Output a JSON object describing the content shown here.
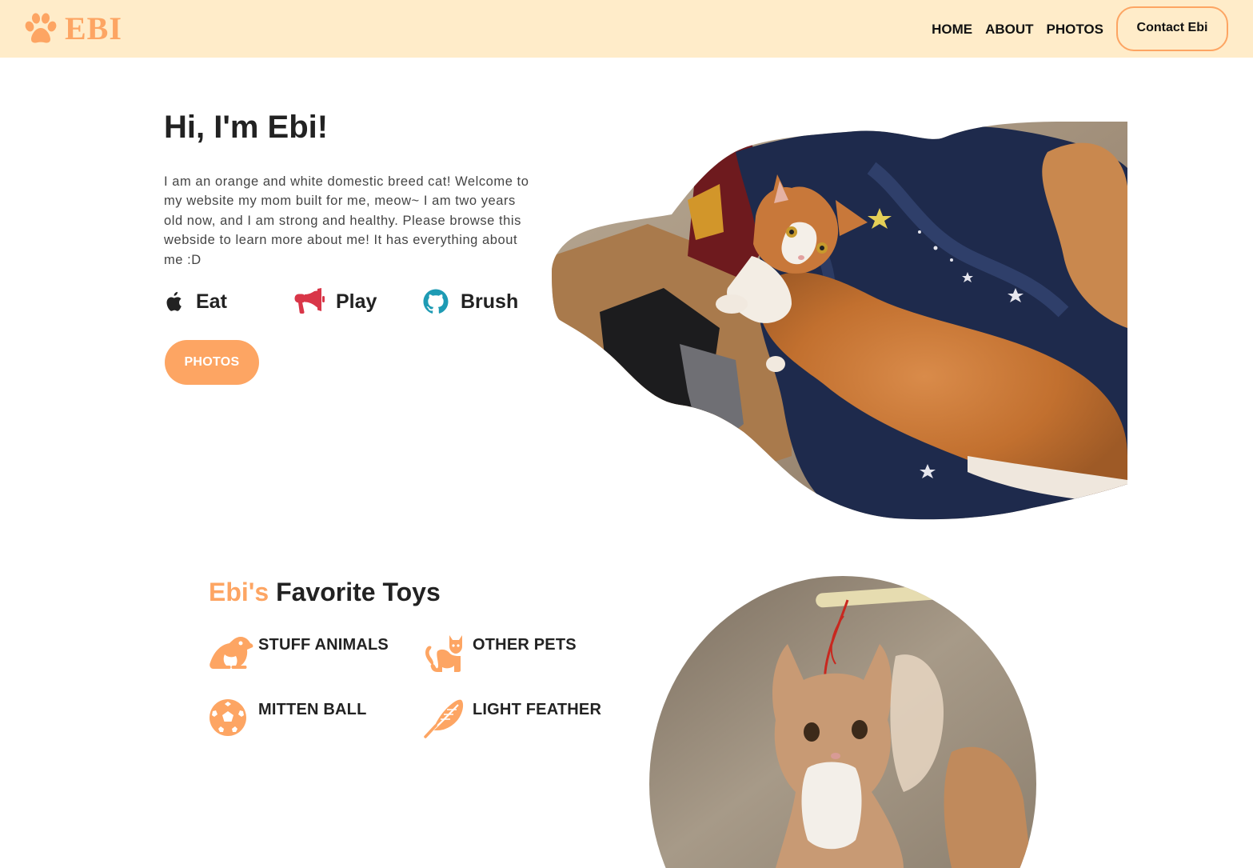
{
  "navbar": {
    "brand_text": "EBI",
    "links": [
      {
        "label": "HOME"
      },
      {
        "label": "ABOUT"
      },
      {
        "label": "PHOTOS"
      }
    ],
    "contact_label": "Contact Ebi"
  },
  "hero": {
    "title": "Hi, I'm Ebi!",
    "description": "I am an orange and white domestic breed cat! Welcome to my website my mom built for me, meow~ I am two years old now, and I am strong and healthy. Please browse this webside to learn more about me! It has everything about me :D",
    "activities": [
      {
        "label": "Eat",
        "icon": "apple-icon",
        "color": "#222222"
      },
      {
        "label": "Play",
        "icon": "megaphone-icon",
        "color": "#d93648"
      },
      {
        "label": "Brush",
        "icon": "github-icon",
        "color": "#1e9bb4"
      }
    ],
    "photos_button": "PHOTOS"
  },
  "toys": {
    "title_accent": "Ebi's",
    "title_rest": "Favorite Toys",
    "items": [
      {
        "label": "STUFF ANIMALS",
        "icon": "frog-icon"
      },
      {
        "label": "OTHER PETS",
        "icon": "cat-icon"
      },
      {
        "label": "MITTEN BALL",
        "icon": "soccer-ball-icon"
      },
      {
        "label": "LIGHT FEATHER",
        "icon": "feather-icon"
      }
    ]
  },
  "colors": {
    "accent": "#fda563",
    "navbar_bg": "#ffecc9",
    "text": "#222222"
  }
}
